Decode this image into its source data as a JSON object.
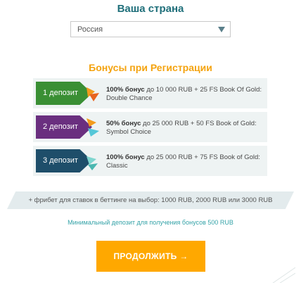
{
  "header": {
    "title": "Ваша страна"
  },
  "country_select": {
    "selected": "Россия"
  },
  "bonus_section": {
    "title": "Бонусы при Регистрации",
    "cards": [
      {
        "label": "1 депозит",
        "bold": "100% бонус",
        "text": " до 10 000 RUB + 25 FS Book Of Gold: Double Chance",
        "color": "#3a8f34"
      },
      {
        "label": "2 депозит",
        "bold": "50% бонус",
        "text": " до 25 000 RUB + 50 FS Book of Gold: Symbol Choice",
        "color": "#6a2f7f"
      },
      {
        "label": "3 депозит",
        "bold": "100% бонус",
        "text": " до 25 000 RUB + 75 FS Book of Gold: Classic",
        "color": "#1e4e6a"
      }
    ]
  },
  "freebet": {
    "text": "+ фрибет для ставок в беттинге на выбор: 1000 RUB, 2000 RUB или 3000 RUB"
  },
  "min_deposit": {
    "text": "Минимальный депозит для получения бонусов 500 RUB"
  },
  "continue_button": {
    "label": "ПРОДОЛЖИТЬ →"
  },
  "colors": {
    "accent": "#ffa800",
    "title": "#1f6f7a",
    "bonus_title": "#f4a30f"
  }
}
